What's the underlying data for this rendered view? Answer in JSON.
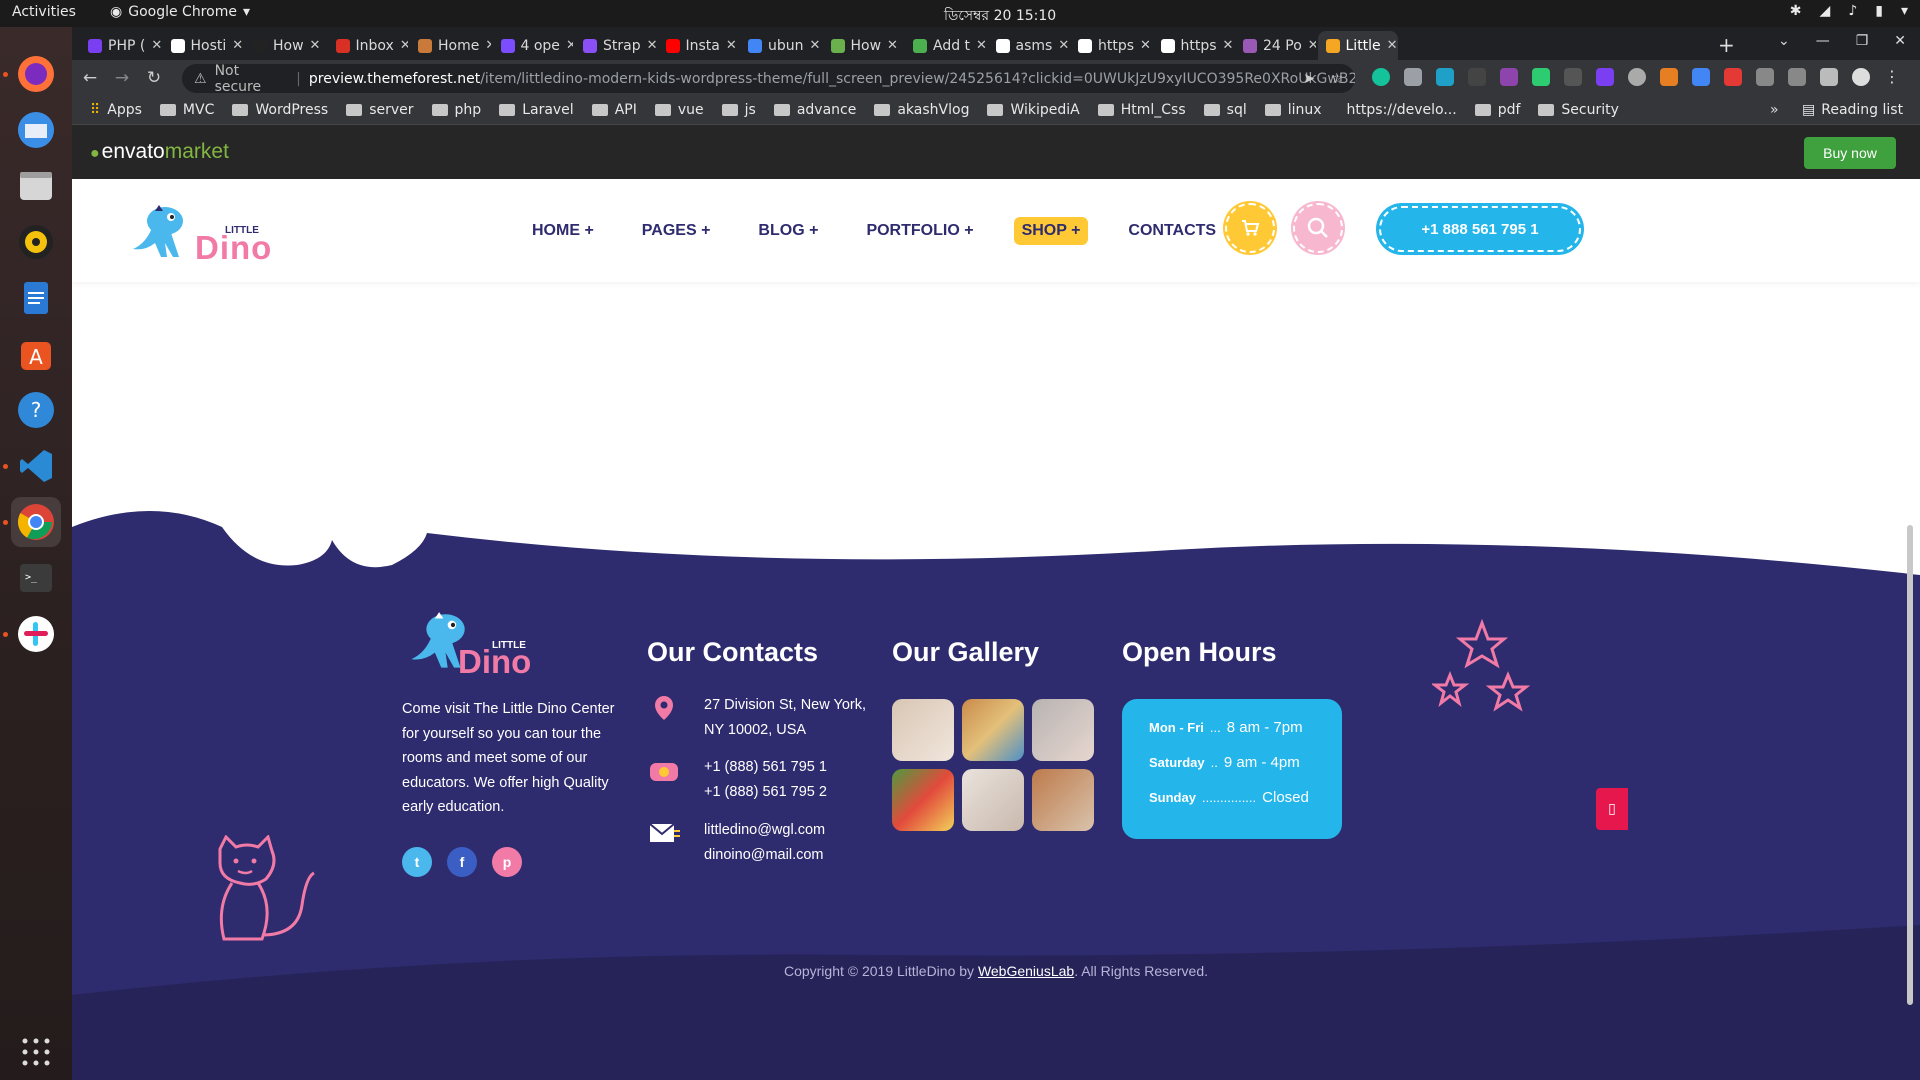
{
  "system": {
    "activities": "Activities",
    "app_name": "Google Chrome",
    "clock": "ডিসেম্বর 20  15:10"
  },
  "browser": {
    "tabs": [
      {
        "label": "PHP (",
        "color": "#7b3ff2"
      },
      {
        "label": "Hosti",
        "color": "#ffffff"
      },
      {
        "label": "How",
        "color": "#222222"
      },
      {
        "label": "Inbox",
        "color": "#d93025"
      },
      {
        "label": "Home",
        "color": "#c97a3a"
      },
      {
        "label": "4 ope",
        "color": "#7c4dff"
      },
      {
        "label": "Strap",
        "color": "#8a4ff5"
      },
      {
        "label": "Insta",
        "color": "#ff0000"
      },
      {
        "label": "ubun",
        "color": "#4285f4"
      },
      {
        "label": "How",
        "color": "#6ab04c"
      },
      {
        "label": "Add t",
        "color": "#4caf50"
      },
      {
        "label": "asms",
        "color": "#ffffff"
      },
      {
        "label": "https",
        "color": "#ffffff"
      },
      {
        "label": "https",
        "color": "#ffffff"
      },
      {
        "label": "24 Po",
        "color": "#9b59b6"
      },
      {
        "label": "Little",
        "color": "#f5a623"
      }
    ],
    "address": {
      "security": "Not secure",
      "host": "preview.themeforest.net",
      "path": "/item/littledino-modern-kids-wordpress-theme/full_screen_preview/24525614?clickid=0UWUkJzU9xyIUCO395Re0XRoUkGwB2z..."
    },
    "bookmarks": [
      "Apps",
      "MVC",
      "WordPress",
      "server",
      "php",
      "Laravel",
      "API",
      "vue",
      "js",
      "advance",
      "akashVlog",
      "WikipediA",
      "Html_Css",
      "sql",
      "linux",
      "https://develo...",
      "pdf",
      "Security"
    ],
    "reading_list": "Reading list"
  },
  "envato": {
    "logo_envato": "envato",
    "logo_market": "market",
    "buy_now": "Buy now"
  },
  "header": {
    "logo_little": "LITTLE",
    "logo_dino": "Dino",
    "nav": [
      "HOME +",
      "PAGES +",
      "BLOG +",
      "PORTFOLIO +",
      "SHOP +",
      "CONTACTS"
    ],
    "phone": "+1 888 561 795 1"
  },
  "footer": {
    "about": "Come visit The Little Dino Center for yourself so you can tour the rooms and meet some of our educators. We offer high Quality early education.",
    "contacts_title": "Our Contacts",
    "address_line1": "27 Division St, New York,",
    "address_line2": "NY 10002, USA",
    "phone1": "+1 (888) 561 795 1",
    "phone2": "+1 (888) 561 795 2",
    "email1": "littledino@wgl.com",
    "email2": "dinoino@mail.com",
    "gallery_title": "Our Gallery",
    "hours_title": "Open Hours",
    "hours": [
      {
        "day": "Mon - Fri",
        "dots": "...",
        "time": "8 am - 7pm"
      },
      {
        "day": "Saturday",
        "dots": "..",
        "time": "9 am - 4pm"
      },
      {
        "day": "Sunday",
        "dots": "...............",
        "time": "Closed"
      }
    ],
    "copyright_pre": "Copyright © 2019 LittleDino by",
    "copyright_brand": "WebGeniusLab",
    "copyright_post": ". All Rights Reserved."
  },
  "colors": {
    "navy": "#2e2b6e",
    "footer_bg": "#2e2b6e",
    "accent_blue": "#24b6ea",
    "accent_yellow": "#ffc935",
    "accent_pink": "#f17ba6"
  }
}
